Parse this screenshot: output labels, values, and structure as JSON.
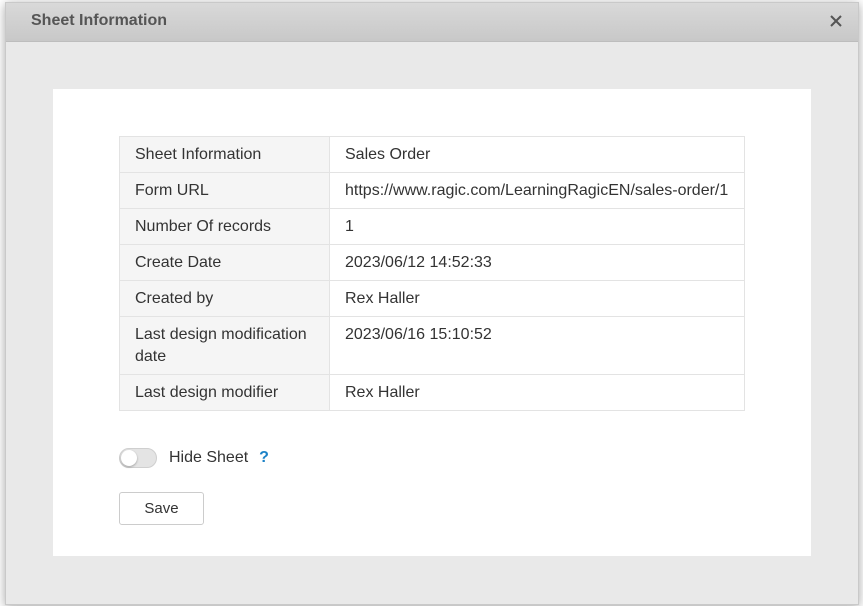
{
  "dialog": {
    "title": "Sheet Information",
    "close_icon": "close-icon"
  },
  "info_rows": [
    {
      "label": "Sheet Information",
      "value": "Sales Order"
    },
    {
      "label": "Form URL",
      "value": "https://www.ragic.com/LearningRagicEN/sales-order/1"
    },
    {
      "label": "Number Of records",
      "value": "1"
    },
    {
      "label": "Create Date",
      "value": "2023/06/12 14:52:33"
    },
    {
      "label": "Created by",
      "value": "Rex Haller"
    },
    {
      "label": "Last design modification date",
      "value": "2023/06/16 15:10:52"
    },
    {
      "label": "Last design modifier",
      "value": "Rex Haller"
    }
  ],
  "hide_sheet": {
    "label": "Hide Sheet",
    "enabled": false,
    "help_text": "?"
  },
  "save_label": "Save",
  "colors": {
    "accent": "#1c82c7",
    "header_bg": "#d0d0d0",
    "label_cell_bg": "#f5f5f5"
  }
}
